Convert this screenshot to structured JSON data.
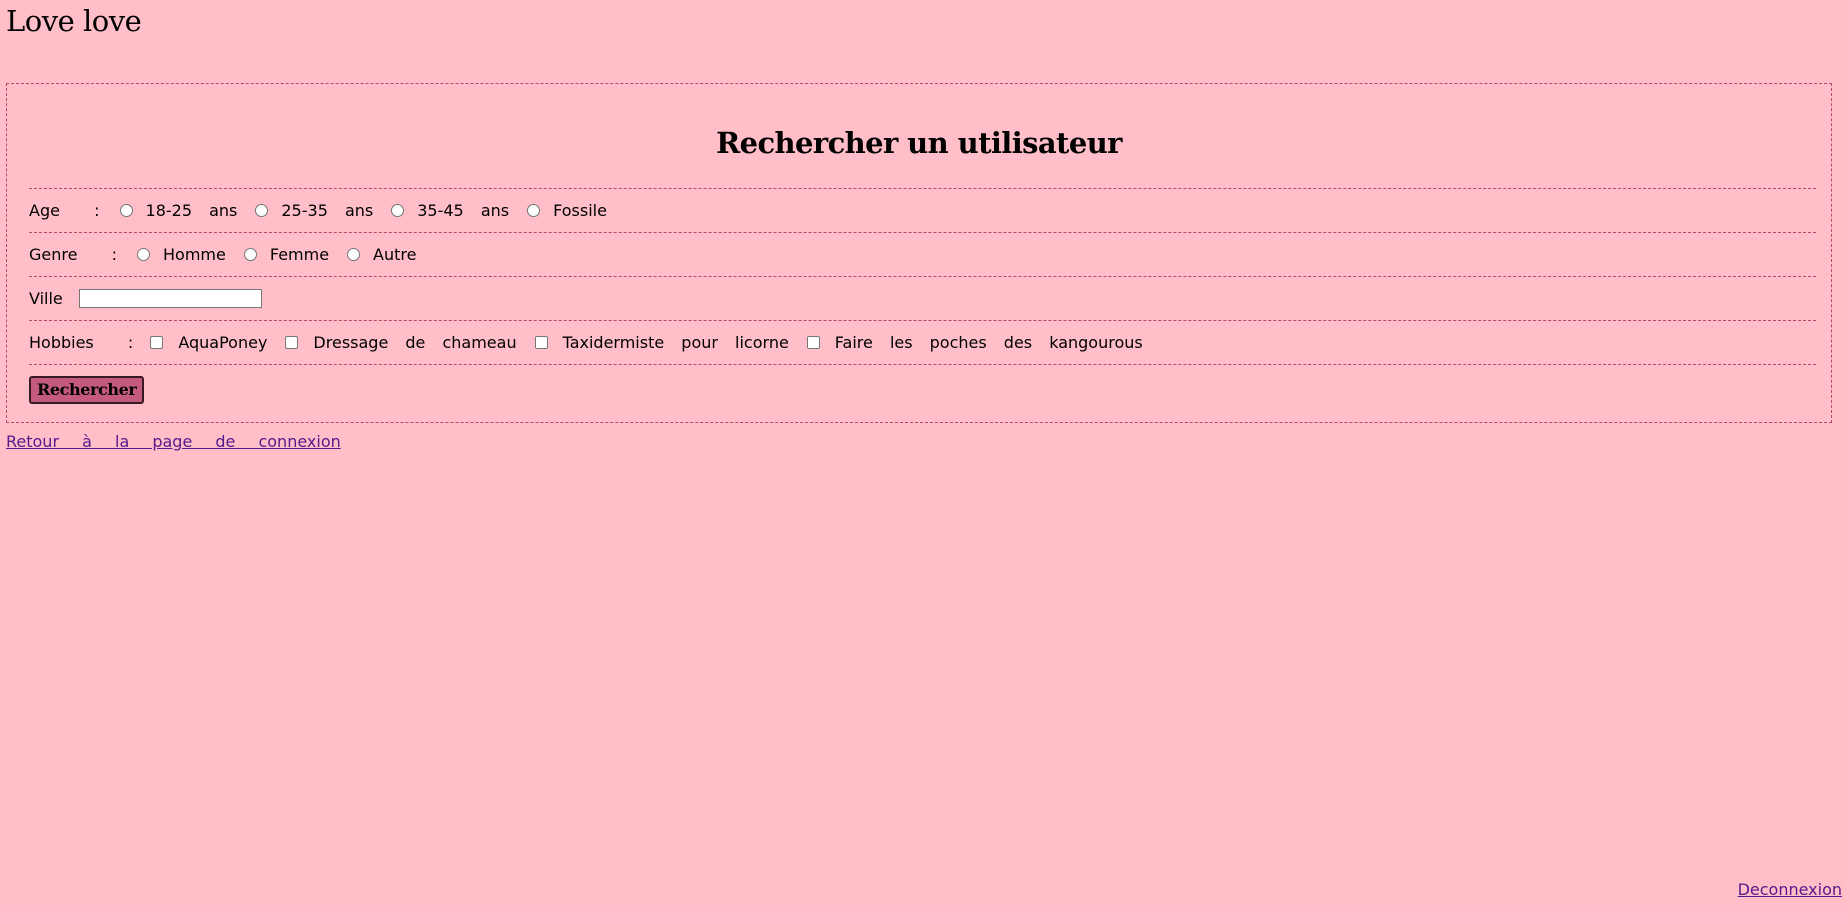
{
  "header": {
    "site_title": "Love love"
  },
  "search": {
    "heading": "Rechercher un utilisateur",
    "age": {
      "label": "Age  :",
      "options": [
        "18-25 ans",
        "25-35 ans",
        "35-45 ans",
        "Fossile"
      ]
    },
    "genre": {
      "label": "Genre  :",
      "options": [
        "Homme",
        "Femme",
        "Autre"
      ]
    },
    "ville": {
      "label": "Ville",
      "value": ""
    },
    "hobbies": {
      "label": "Hobbies  :",
      "options": [
        "AquaPoney",
        "Dressage de chameau",
        "Taxidermiste pour licorne",
        "Faire les poches des kangourous"
      ]
    },
    "submit_label": "Rechercher"
  },
  "links": {
    "back_to_login": "Retour à la page de connexion",
    "logout": "Deconnexion"
  },
  "colors": {
    "background": "#ffbec8",
    "accent": "#c45a7d",
    "border": "#b04b6e",
    "link": "#551a8b"
  }
}
